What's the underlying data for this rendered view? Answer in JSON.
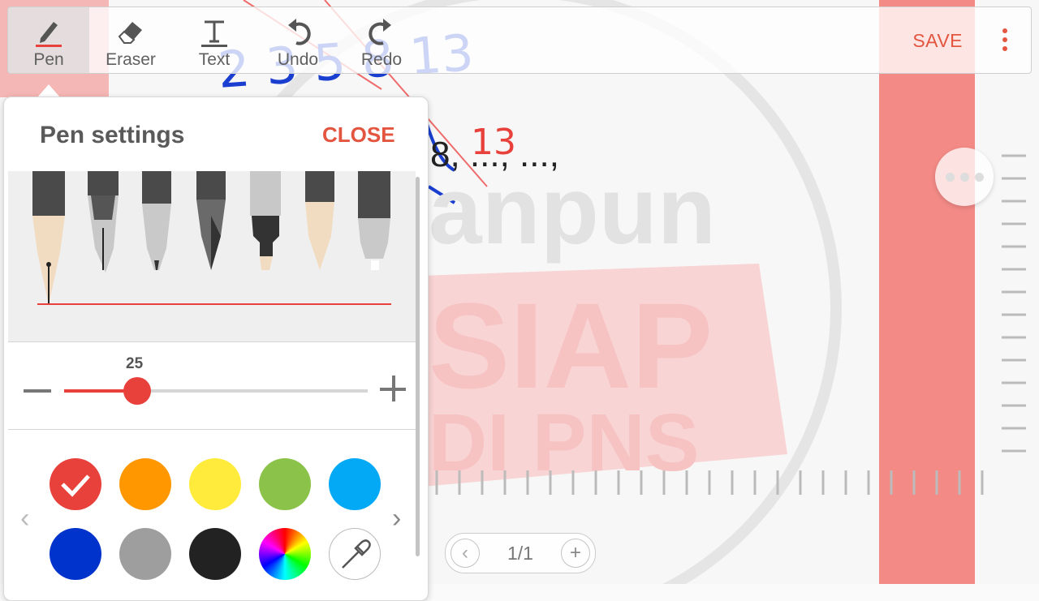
{
  "toolbar": {
    "tools": [
      {
        "label": "Pen"
      },
      {
        "label": "Eraser"
      },
      {
        "label": "Text"
      },
      {
        "label": "Undo"
      },
      {
        "label": "Redo"
      }
    ],
    "save_label": "SAVE"
  },
  "canvas": {
    "handwriting_top": "2 3 5 8 13",
    "sequence_text": "8, ..., ...,",
    "handwriting_red": "13",
    "watermark_line1": "anpun",
    "watermark_line2": "SIAP",
    "watermark_line3": "DI PNS"
  },
  "pen_settings": {
    "title": "Pen settings",
    "close_label": "CLOSE",
    "pen_types": [
      "fountain-pen",
      "calligraphy-pen",
      "ballpoint-pen",
      "brush-pen",
      "marker-pen",
      "pencil-soft",
      "pencil"
    ],
    "selected_pen": 0,
    "size_value": "25",
    "size_fraction": 0.24,
    "colors": [
      {
        "name": "red",
        "hex": "#e8413b",
        "selected": true
      },
      {
        "name": "orange",
        "hex": "#ff9800"
      },
      {
        "name": "yellow",
        "hex": "#ffeb3b"
      },
      {
        "name": "green",
        "hex": "#8bc34a"
      },
      {
        "name": "light-blue",
        "hex": "#03a9f4"
      },
      {
        "name": "dark-blue",
        "hex": "#0033cc"
      },
      {
        "name": "gray",
        "hex": "#9e9e9e"
      },
      {
        "name": "black",
        "hex": "#222222"
      },
      {
        "name": "color-wheel"
      },
      {
        "name": "eyedropper"
      }
    ]
  },
  "pager": {
    "page_label": "1/1"
  }
}
